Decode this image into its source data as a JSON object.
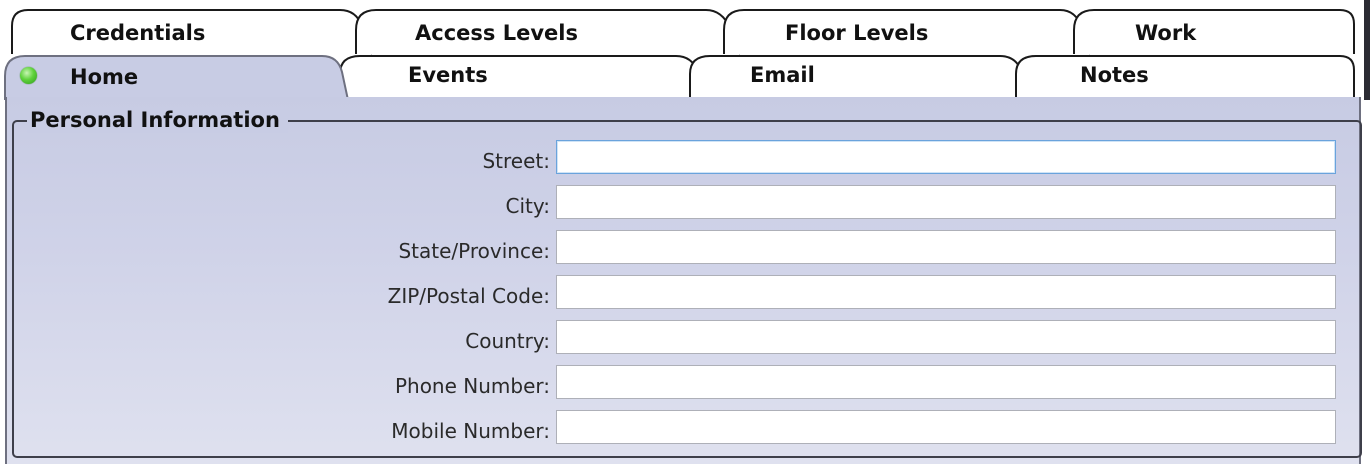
{
  "tabs": {
    "row_top": [
      {
        "id": "credentials",
        "label": "Credentials"
      },
      {
        "id": "access-levels",
        "label": "Access Levels"
      },
      {
        "id": "floor-levels",
        "label": "Floor Levels"
      },
      {
        "id": "work",
        "label": "Work"
      }
    ],
    "row_bottom": [
      {
        "id": "home",
        "label": "Home",
        "selected": true,
        "status_icon": "green-status-dot-icon"
      },
      {
        "id": "events",
        "label": "Events"
      },
      {
        "id": "email",
        "label": "Email"
      },
      {
        "id": "notes",
        "label": "Notes"
      }
    ]
  },
  "group": {
    "title": "Personal Information"
  },
  "fields": [
    {
      "id": "street",
      "label": "Street:",
      "value": "",
      "focused": true
    },
    {
      "id": "city",
      "label": "City:",
      "value": ""
    },
    {
      "id": "state-province",
      "label": "State/Province:",
      "value": ""
    },
    {
      "id": "zip-postal-code",
      "label": "ZIP/Postal Code:",
      "value": ""
    },
    {
      "id": "country",
      "label": "Country:",
      "value": ""
    },
    {
      "id": "phone-number",
      "label": "Phone Number:",
      "value": ""
    },
    {
      "id": "mobile-number",
      "label": "Mobile Number:",
      "value": ""
    }
  ],
  "colors": {
    "panel_background": "#c7cbe3",
    "selected_tab_background": "#c8cce4",
    "focus_border": "#6aa3dc",
    "status_dot": "#4cc12f"
  }
}
